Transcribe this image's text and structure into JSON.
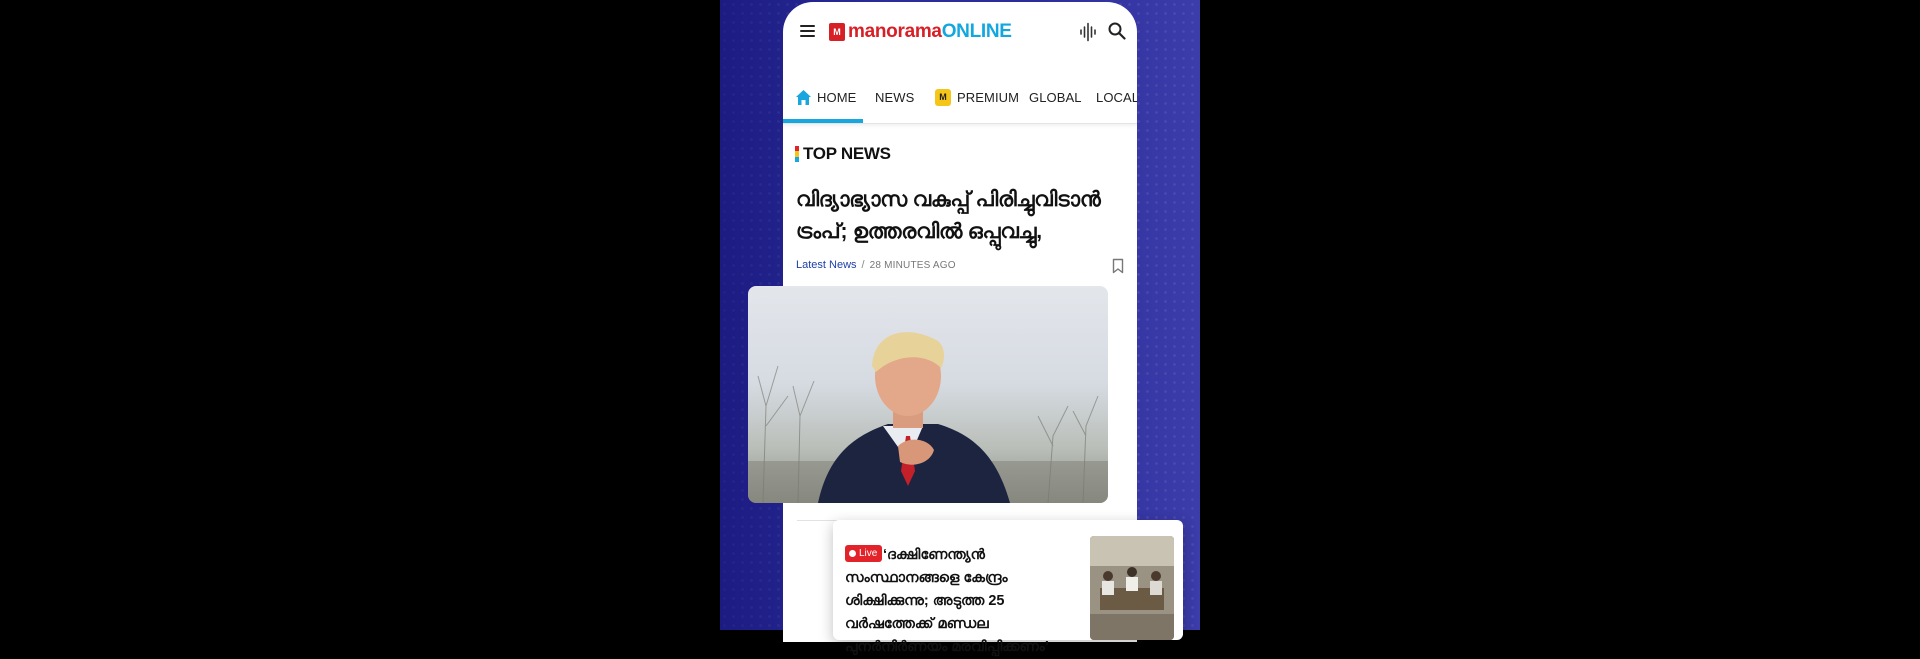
{
  "app": {
    "logo": {
      "brand": "manorama",
      "suffix": "ONLINE",
      "brand_color": "#d71f26",
      "suffix_color": "#13a7df"
    },
    "icons": {
      "menu": "hamburger-menu-icon",
      "voice": "audio-wave-icon",
      "search": "search-icon"
    }
  },
  "tabs": [
    {
      "label": "HOME",
      "icon": "home-icon",
      "active": true
    },
    {
      "label": "NEWS"
    },
    {
      "label": "PREMIUM",
      "icon": "premium-badge-icon"
    },
    {
      "label": "GLOBAL"
    },
    {
      "label": "LOCAL"
    }
  ],
  "accent_color": "#18a6de",
  "section": {
    "title": "TOP NEWS"
  },
  "top_story": {
    "headline": "വിദ്യാഭ്യാസ വകുപ്പ് പിരിച്ചുവിടാൻ ട്രംപ്; ഉത്തരവിൽ ഒപ്പുവച്ചു,",
    "category": "Latest News",
    "time": "28 MINUTES AGO",
    "bookmark_icon": "bookmark-icon"
  },
  "live_card": {
    "badge": "Live",
    "text": "‘ദക്ഷിണേന്ത്യൻ സംസ്ഥാനങ്ങളെ കേന്ദ്രം ശിക്ഷിക്കുന്നു; അടുത്ത 25 വർഷത്തേക്ക് മണ്ഡല പുനർനിർണയം മരവിപ്പിക്കണം’"
  }
}
